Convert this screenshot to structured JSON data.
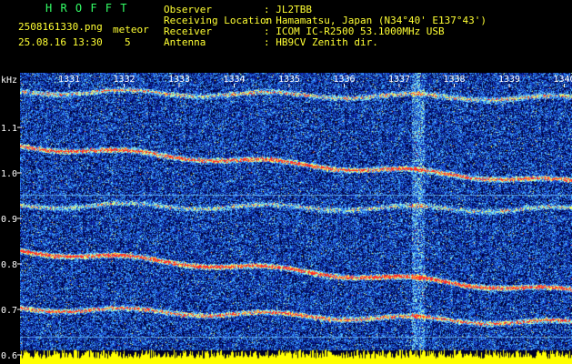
{
  "header": {
    "app_title": "H R O F F T",
    "filename": "2508161330.png",
    "meteor_label": "meteor",
    "datetime": "25.08.16 13:30",
    "meteor_count": "5",
    "observer_label": "Observer",
    "observer_value": ": JL2TBB",
    "location_label": "Receiving Location",
    "location_value": ": Hamamatsu, Japan (N34°40' E137°43')",
    "receiver_label": "Receiver",
    "receiver_value": ": ICOM IC-R2500 53.1000MHz USB",
    "antenna_label": "Antenna",
    "antenna_value": ": HB9CV Zenith dir."
  },
  "chart_data": {
    "type": "heatmap",
    "ylabel": "kHz",
    "y_ticks": [
      "1.1",
      "1.0",
      "0.9",
      "0.8",
      "0.7",
      "0.6"
    ],
    "x_ticks": [
      "1331",
      "1332",
      "1333",
      "1334",
      "1335",
      "1336",
      "1337",
      "1338",
      "1339",
      "1340"
    ],
    "ylim": [
      0.58,
      1.22
    ],
    "colors": {
      "background": "#000000",
      "header_green": "#33ff66",
      "header_yellow": "#ffff33",
      "signal_red": "#ff3333",
      "noise_blue": "#1030c0",
      "noise_cyan": "#30c0ff"
    }
  }
}
